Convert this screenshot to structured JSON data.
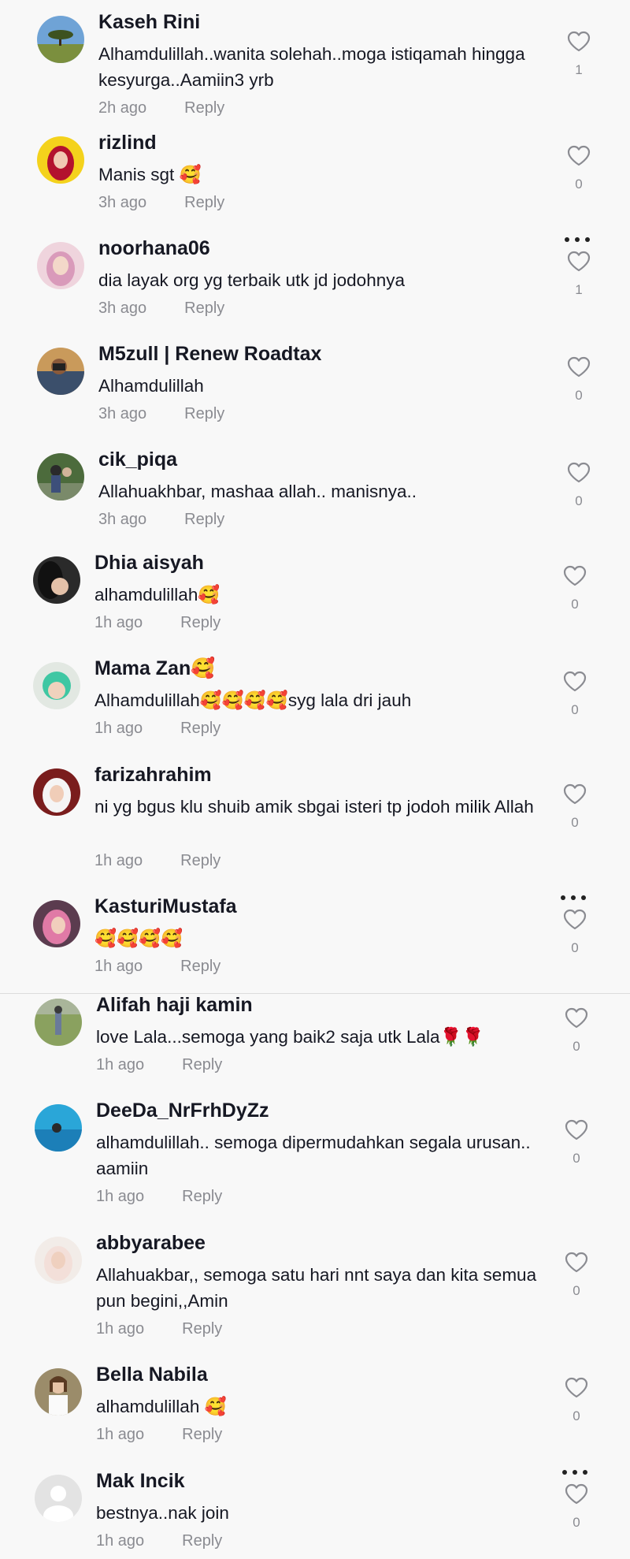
{
  "comments": [
    {
      "username": "Kaseh Rini",
      "text": "Alhamdulillah..wanita solehah..moga istiqamah hingga kesyurga..Aamiin3 yrb",
      "time": "2h ago",
      "reply": "Reply",
      "likes": "1",
      "avatar": "landscape-tree",
      "more": false
    },
    {
      "username": "rizlind",
      "text": "Manis sgt 🥰",
      "time": "3h ago",
      "reply": "Reply",
      "likes": "0",
      "avatar": "hijab-red",
      "more": false
    },
    {
      "username": "noorhana06",
      "text": "dia layak org yg terbaik utk jd jodohnya",
      "time": "3h ago",
      "reply": "Reply",
      "likes": "1",
      "avatar": "hijab-pink",
      "more": true
    },
    {
      "username": "M5zull | Renew Roadtax",
      "text": "Alhamdulillah",
      "time": "3h ago",
      "reply": "Reply",
      "likes": "0",
      "avatar": "man-camera",
      "more": false
    },
    {
      "username": "cik_piqa",
      "text": "Allahuakhbar, mashaa allah.. manisnya..",
      "time": "3h ago",
      "reply": "Reply",
      "likes": "0",
      "avatar": "people-outdoor",
      "more": false
    },
    {
      "username": "Dhia aisyah",
      "text": "alhamdulillah🥰",
      "time": "1h ago",
      "reply": "Reply",
      "likes": "0",
      "avatar": "mother-baby",
      "more": false
    },
    {
      "username": "Mama Zan🥰",
      "text": "Alhamdulillah🥰🥰🥰🥰syg lala dri jauh",
      "time": "1h ago",
      "reply": "Reply",
      "likes": "0",
      "avatar": "baby-green",
      "more": false
    },
    {
      "username": "farizahrahim",
      "text": "ni yg bgus klu shuib amik sbgai isteri tp jodoh milik Allah",
      "time": "1h ago",
      "reply": "Reply",
      "likes": "0",
      "avatar": "hijab-white",
      "more": false
    },
    {
      "username": "KasturiMustafa",
      "text": "🥰🥰🥰🥰",
      "time": "1h ago",
      "reply": "Reply",
      "likes": "0",
      "avatar": "hijab-purple",
      "more": true
    },
    {
      "username": "Alifah haji kamin",
      "text": "love Lala...semoga yang baik2 saja utk Lala🌹🌹",
      "time": "1h ago",
      "reply": "Reply",
      "likes": "0",
      "avatar": "person-field",
      "more": false
    },
    {
      "username": "DeeDa_NrFrhDyZz",
      "text": "alhamdulillah.. semoga dipermudahkan segala urusan.. aamiin",
      "time": "1h ago",
      "reply": "Reply",
      "likes": "0",
      "avatar": "sea-blue",
      "more": false
    },
    {
      "username": "abbyarabee",
      "text": "Allahuakbar,, semoga satu hari nnt saya dan kita semua pun begini,,Amin",
      "time": "1h ago",
      "reply": "Reply",
      "likes": "0",
      "avatar": "hijab-light",
      "more": false
    },
    {
      "username": "Bella Nabila",
      "text": "alhamdulillah 🥰",
      "time": "1h ago",
      "reply": "Reply",
      "likes": "0",
      "avatar": "girl-white",
      "more": false
    },
    {
      "username": "Mak Incik",
      "text": "bestnya..nak join",
      "time": "1h ago",
      "reply": "Reply",
      "likes": "0",
      "avatar": "default-user",
      "more": true
    }
  ],
  "colors": {
    "text": "#161823",
    "muted": "#8a8b91",
    "background": "#f8f8f8"
  }
}
